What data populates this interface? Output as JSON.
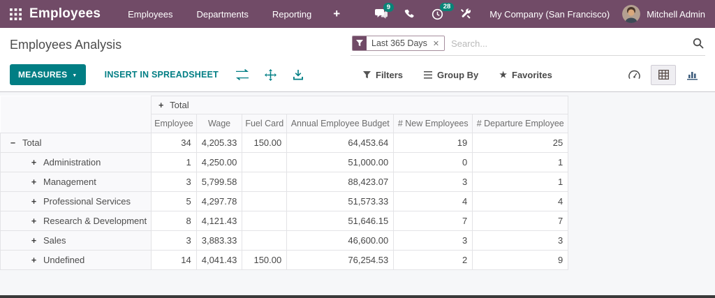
{
  "navbar": {
    "brand": "Employees",
    "menus": [
      "Employees",
      "Departments",
      "Reporting"
    ],
    "messages_badge": "9",
    "activities_badge": "28",
    "company": "My Company (San Francisco)",
    "user": "Mitchell Admin"
  },
  "control_panel": {
    "title": "Employees Analysis",
    "facet_label": "Last 365 Days",
    "search_placeholder": "Search...",
    "measures_label": "MEASURES",
    "insert_spreadsheet_label": "INSERT IN SPREADSHEET",
    "filters_label": "Filters",
    "group_by_label": "Group By",
    "favorites_label": "Favorites"
  },
  "pivot": {
    "column_group_label": "Total",
    "measures": [
      "Employee",
      "Wage",
      "Fuel Card",
      "Annual Employee Budget",
      "# New Employees",
      "# Departure Employee"
    ],
    "rows": [
      {
        "label": "Total",
        "level": 0,
        "expanded": true,
        "values": [
          "34",
          "4,205.33",
          "150.00",
          "64,453.64",
          "19",
          "25"
        ]
      },
      {
        "label": "Administration",
        "level": 1,
        "expanded": false,
        "values": [
          "1",
          "4,250.00",
          "",
          "51,000.00",
          "0",
          "1"
        ]
      },
      {
        "label": "Management",
        "level": 1,
        "expanded": false,
        "values": [
          "3",
          "5,799.58",
          "",
          "88,423.07",
          "3",
          "1"
        ]
      },
      {
        "label": "Professional Services",
        "level": 1,
        "expanded": false,
        "values": [
          "5",
          "4,297.78",
          "",
          "51,573.33",
          "4",
          "4"
        ]
      },
      {
        "label": "Research & Development",
        "level": 1,
        "expanded": false,
        "values": [
          "8",
          "4,121.43",
          "",
          "51,646.15",
          "7",
          "7"
        ]
      },
      {
        "label": "Sales",
        "level": 1,
        "expanded": false,
        "values": [
          "3",
          "3,883.33",
          "",
          "46,600.00",
          "3",
          "3"
        ]
      },
      {
        "label": "Undefined",
        "level": 1,
        "expanded": false,
        "values": [
          "14",
          "4,041.43",
          "150.00",
          "76,254.53",
          "2",
          "9"
        ]
      }
    ]
  },
  "colors": {
    "navbar_bg": "#714B67",
    "accent_teal": "#017E84",
    "badge_bg": "#0A8478",
    "table_header_bg": "#f9f9fb",
    "content_bg": "#f6f7f9"
  }
}
